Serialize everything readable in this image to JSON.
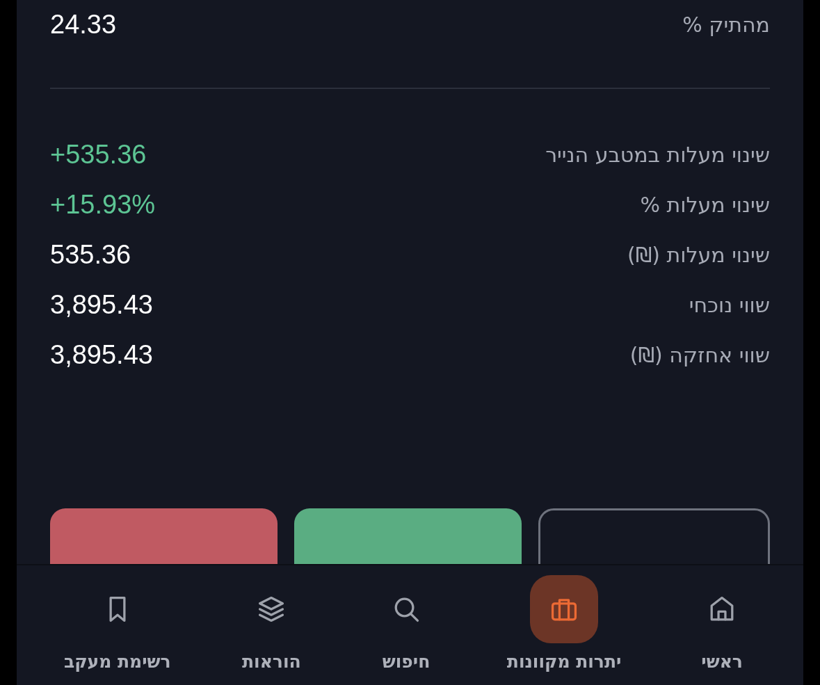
{
  "summary": {
    "label": "מהתיק %",
    "value": "24.33",
    "color": "#ffffff"
  },
  "rows": [
    {
      "label": "שינוי מעלות במטבע הנייר",
      "value": "+535.36",
      "color": "#5dc594"
    },
    {
      "label": "שינוי מעלות %",
      "value": "+15.93%",
      "color": "#5dc594"
    },
    {
      "label": "שינוי מעלות (₪)",
      "value": "535.36",
      "color": "#ffffff"
    },
    {
      "label": "שווי נוכחי",
      "value": "3,895.43",
      "color": "#ffffff"
    },
    {
      "label": "שווי אחזקה (₪)",
      "value": "3,895.43",
      "color": "#ffffff"
    }
  ],
  "actions": [
    {
      "kind": "outline"
    },
    {
      "kind": "buy"
    },
    {
      "kind": "sell"
    }
  ],
  "nav": [
    {
      "label": "ראשי",
      "selected": false
    },
    {
      "label": "יתרות מקוונות",
      "selected": true
    },
    {
      "label": "חיפוש",
      "selected": false
    },
    {
      "label": "הוראות",
      "selected": false
    },
    {
      "label": "רשימת מעקב",
      "selected": false
    }
  ]
}
